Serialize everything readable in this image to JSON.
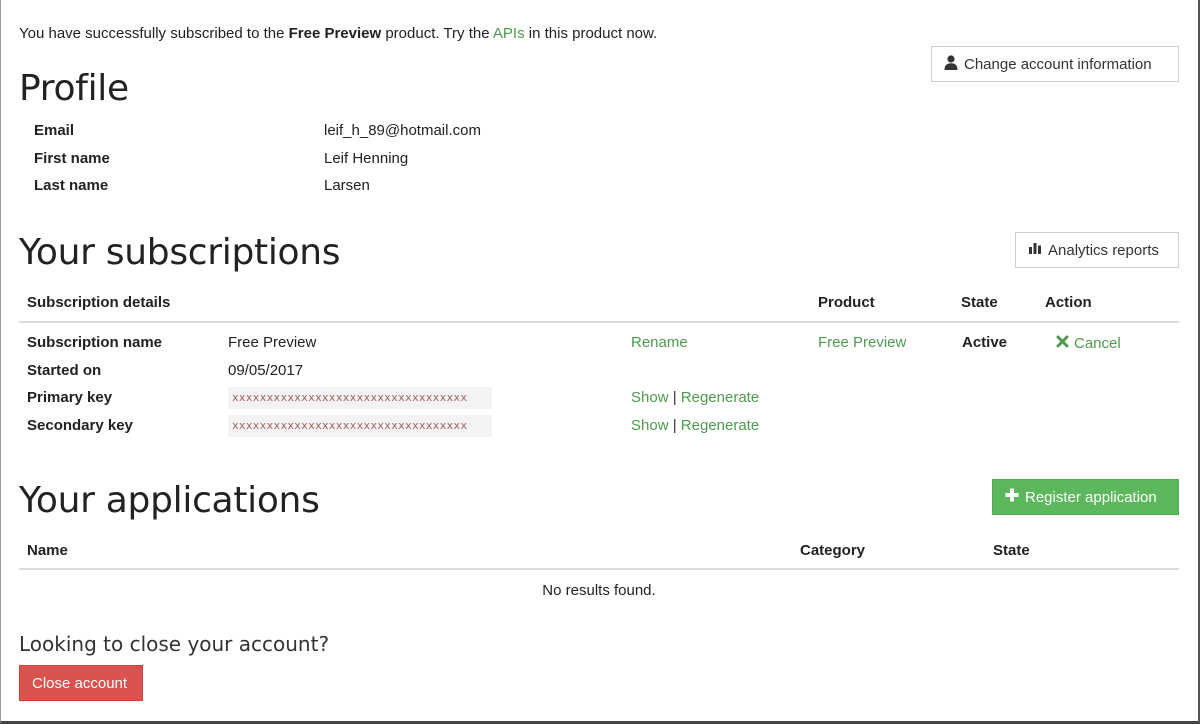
{
  "notice": {
    "prefix": "You have successfully subscribed to the ",
    "product": "Free Preview",
    "middle": " product. Try the ",
    "apis_link": "APIs",
    "suffix": " in this product now."
  },
  "profile": {
    "title": "Profile",
    "change_button": "Change account information",
    "fields": [
      {
        "label": "Email",
        "value": "leif_h_89@hotmail.com"
      },
      {
        "label": "First name",
        "value": "Leif Henning"
      },
      {
        "label": "Last name",
        "value": "Larsen"
      }
    ]
  },
  "subscriptions": {
    "title": "Your subscriptions",
    "analytics_button": "Analytics reports",
    "headers": {
      "details": "Subscription details",
      "product": "Product",
      "state": "State",
      "action": "Action"
    },
    "name_label": "Subscription name",
    "name_value": "Free Preview",
    "rename": "Rename",
    "started_label": "Started on",
    "started_value": "09/05/2017",
    "primary_label": "Primary key",
    "primary_value": "xxxxxxxxxxxxxxxxxxxxxxxxxxxxxxxxxx",
    "secondary_label": "Secondary key",
    "secondary_value": "xxxxxxxxxxxxxxxxxxxxxxxxxxxxxxxxxx",
    "show": "Show",
    "separator": "|",
    "regenerate": "Regenerate",
    "product": "Free Preview",
    "state": "Active",
    "cancel": "Cancel"
  },
  "applications": {
    "title": "Your applications",
    "register_button": "Register application",
    "headers": {
      "name": "Name",
      "category": "Category",
      "state": "State"
    },
    "empty": "No results found."
  },
  "close_account": {
    "question": "Looking to close your account?",
    "button": "Close account"
  }
}
